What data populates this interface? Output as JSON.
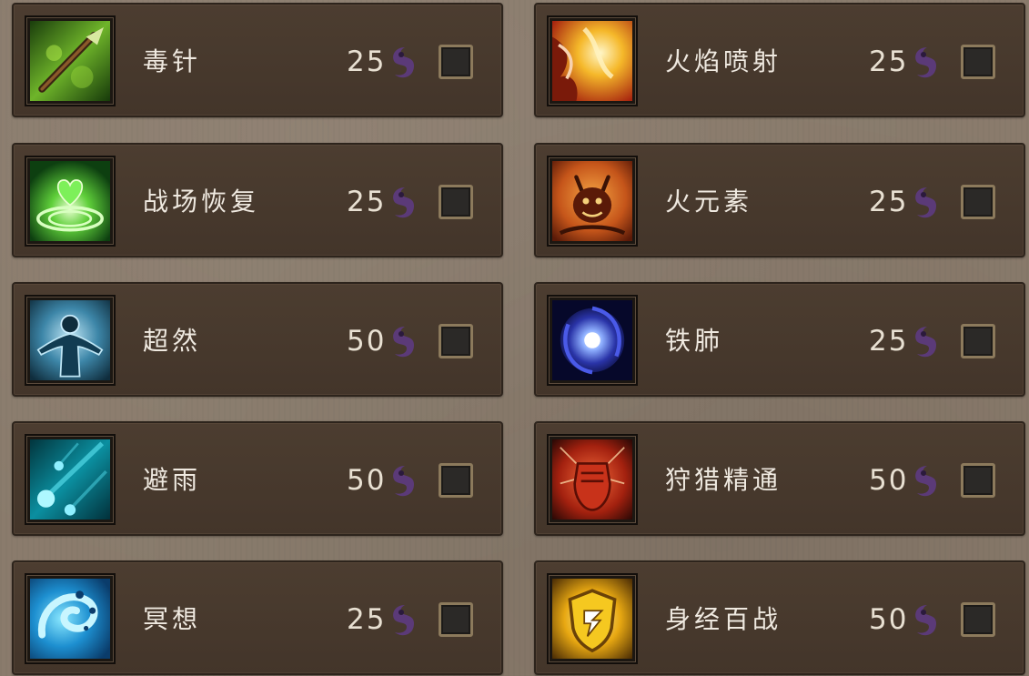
{
  "accent_colors": {
    "card_bg": "#473a2e",
    "checkbox_border": "#8c7a5c",
    "essence_purple": "#5b3a78",
    "text": "#efe9e0"
  },
  "currency_icon": "essence-icon",
  "left_column": [
    {
      "name": "毒针",
      "cost": "25",
      "icon": "poison-needle-icon",
      "checked": false
    },
    {
      "name": "战场恢复",
      "cost": "25",
      "icon": "battlefield-recovery-icon",
      "checked": false
    },
    {
      "name": "超然",
      "cost": "50",
      "icon": "transcendence-icon",
      "checked": false
    },
    {
      "name": "避雨",
      "cost": "50",
      "icon": "rain-shelter-icon",
      "checked": false
    },
    {
      "name": "冥想",
      "cost": "25",
      "icon": "meditation-icon",
      "checked": false
    }
  ],
  "right_column": [
    {
      "name": "火焰喷射",
      "cost": "25",
      "icon": "flame-jet-icon",
      "checked": false
    },
    {
      "name": "火元素",
      "cost": "25",
      "icon": "fire-elemental-icon",
      "checked": false
    },
    {
      "name": "铁肺",
      "cost": "25",
      "icon": "iron-lung-icon",
      "checked": false
    },
    {
      "name": "狩猎精通",
      "cost": "50",
      "icon": "hunting-mastery-icon",
      "checked": false
    },
    {
      "name": "身经百战",
      "cost": "50",
      "icon": "battle-hardened-icon",
      "checked": false
    }
  ]
}
